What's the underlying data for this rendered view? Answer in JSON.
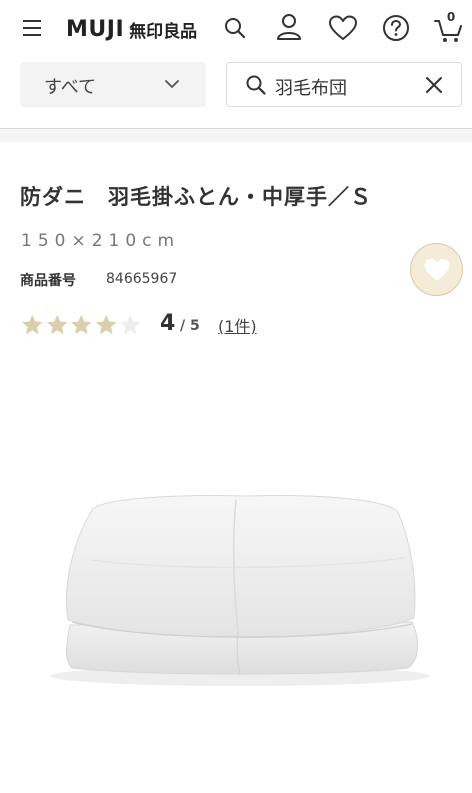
{
  "header": {
    "logo_en": "MUJI",
    "logo_ja": "無印良品",
    "cart_count": "0",
    "icons": [
      "menu-icon",
      "search-icon",
      "user-icon",
      "heart-icon",
      "help-icon",
      "cart-icon"
    ]
  },
  "search": {
    "category": "すべて",
    "query": "羽毛布団"
  },
  "product": {
    "title": "防ダニ　羽毛掛ふとん・中厚手／Ｓ",
    "size": "150×210cm",
    "product_number_label": "商品番号",
    "product_number": "84665967",
    "rating": {
      "value": 4,
      "max": 5,
      "value_text": "4",
      "max_text": "/ 5",
      "review_count_text": "(1件)"
    }
  },
  "colors": {
    "star_filled": "#d9cfae",
    "star_empty": "#eeeeee",
    "fav_bg": "#f4ecd9",
    "fav_border": "#d9c9a3",
    "fav_heart": "#ffffff"
  }
}
